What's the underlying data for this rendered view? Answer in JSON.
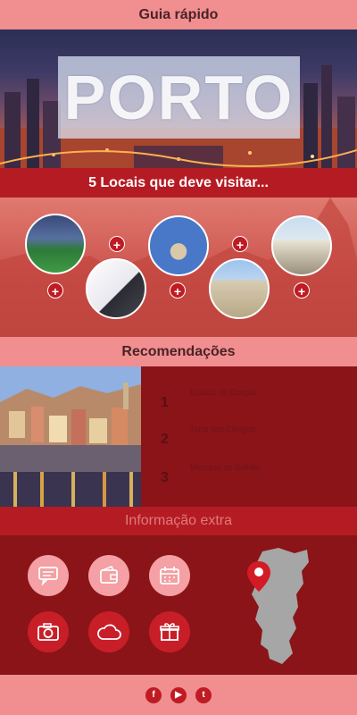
{
  "header": {
    "title": "Guia rápido"
  },
  "hero": {
    "city_name": "PORTO"
  },
  "places": {
    "heading": "5 Locais que deve visitar...",
    "plus_symbol": "+"
  },
  "recommendations": {
    "heading": "Recomendações",
    "items": [
      {
        "number": "1",
        "label": "Estádio do Dragão"
      },
      {
        "number": "2",
        "label": "Torre dos Clérigos"
      },
      {
        "number": "3",
        "label": "Mercado do Bolhão"
      }
    ]
  },
  "extra": {
    "heading": "Informação extra",
    "icons": [
      "chat-icon",
      "wallet-icon",
      "calendar-icon",
      "camera-icon",
      "cloud-icon",
      "gift-icon"
    ]
  },
  "footer": {
    "social": [
      {
        "icon": "facebook-icon",
        "glyph": "f"
      },
      {
        "icon": "youtube-icon",
        "glyph": "▶"
      },
      {
        "icon": "twitter-icon",
        "glyph": "t"
      }
    ]
  },
  "colors": {
    "accent_red": "#b51b23",
    "pink": "#f08e90",
    "dark_red": "#8a1418"
  }
}
